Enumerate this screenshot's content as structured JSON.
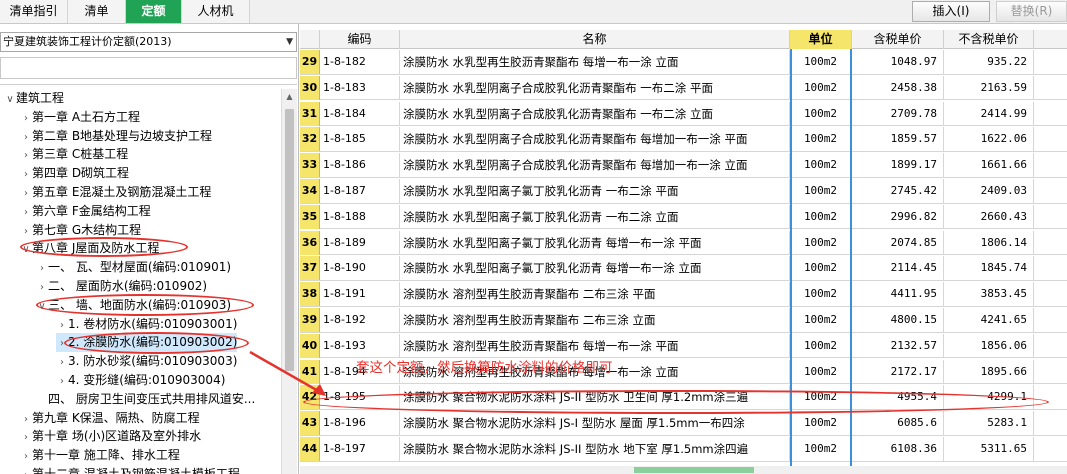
{
  "tabs": [
    {
      "label": "清单指引",
      "active": false
    },
    {
      "label": "清单",
      "active": false
    },
    {
      "label": "定额",
      "active": true
    },
    {
      "label": "人材机",
      "active": false
    }
  ],
  "toolbar": {
    "insert_label": "插入(I)",
    "replace_label": "替换(R)"
  },
  "library": {
    "selected": "宁夏建筑装饰工程计价定额(2013)"
  },
  "search": {
    "value": ""
  },
  "tree": [
    {
      "label": "建筑工程",
      "level": 0,
      "expanded": true
    },
    {
      "label": "第一章 A土石方工程",
      "level": 1
    },
    {
      "label": "第二章 B地基处理与边坡支护工程",
      "level": 1
    },
    {
      "label": "第三章 C桩基工程",
      "level": 1
    },
    {
      "label": "第四章 D砌筑工程",
      "level": 1
    },
    {
      "label": "第五章 E混凝土及钢筋混凝土工程",
      "level": 1
    },
    {
      "label": "第六章 F金属结构工程",
      "level": 1
    },
    {
      "label": "第七章 G木结构工程",
      "level": 1
    },
    {
      "label": "第八章 J屋面及防水工程",
      "level": 1,
      "expanded": true
    },
    {
      "label": "一、 瓦、型材屋面(编码:010901)",
      "level": 2
    },
    {
      "label": "二、 屋面防水(编码:010902)",
      "level": 2
    },
    {
      "label": "三、 墙、地面防水(编码:010903)",
      "level": 2,
      "expanded": true
    },
    {
      "label": "1. 卷材防水(编码:010903001)",
      "level": 3
    },
    {
      "label": "2. 涂膜防水(编码:010903002)",
      "level": 3,
      "selected": true
    },
    {
      "label": "3. 防水砂浆(编码:010903003)",
      "level": 3
    },
    {
      "label": "4. 变形缝(编码:010903004)",
      "level": 3
    },
    {
      "label": "四、 厨房卫生间变压式共用排风道安...",
      "level": 2,
      "noexp": true
    },
    {
      "label": "第九章 K保温、隔热、防腐工程",
      "level": 1
    },
    {
      "label": "第十章 场(小)区道路及室外排水",
      "level": 1
    },
    {
      "label": "第十一章 施工降、排水工程",
      "level": 1
    },
    {
      "label": "第十二章 混凝土及钢筋混凝土模板工程",
      "level": 1
    }
  ],
  "grid": {
    "headers": {
      "code": "编码",
      "name": "名称",
      "unit": "单位",
      "tax": "含税单价",
      "notax": "不含税单价"
    },
    "rows": [
      {
        "no": "29",
        "code": "1-8-182",
        "name": "涂膜防水 水乳型再生胶沥青聚酯布 每增一布一涂 立面",
        "unit": "100m2",
        "tax": "1048.97",
        "notax": "935.22"
      },
      {
        "no": "30",
        "code": "1-8-183",
        "name": "涂膜防水 水乳型阴离子合成胶乳化沥青聚酯布 一布二涂 平面",
        "unit": "100m2",
        "tax": "2458.38",
        "notax": "2163.59"
      },
      {
        "no": "31",
        "code": "1-8-184",
        "name": "涂膜防水 水乳型阴离子合成胶乳化沥青聚酯布 一布二涂 立面",
        "unit": "100m2",
        "tax": "2709.78",
        "notax": "2414.99"
      },
      {
        "no": "32",
        "code": "1-8-185",
        "name": "涂膜防水 水乳型阴离子合成胶乳化沥青聚酯布 每增加一布一涂 平面",
        "unit": "100m2",
        "tax": "1859.57",
        "notax": "1622.06"
      },
      {
        "no": "33",
        "code": "1-8-186",
        "name": "涂膜防水 水乳型阴离子合成胶乳化沥青聚酯布 每增加一布一涂 立面",
        "unit": "100m2",
        "tax": "1899.17",
        "notax": "1661.66"
      },
      {
        "no": "34",
        "code": "1-8-187",
        "name": "涂膜防水 水乳型阳离子氯丁胶乳化沥青 一布二涂 平面",
        "unit": "100m2",
        "tax": "2745.42",
        "notax": "2409.03"
      },
      {
        "no": "35",
        "code": "1-8-188",
        "name": "涂膜防水 水乳型阳离子氯丁胶乳化沥青 一布二涂 立面",
        "unit": "100m2",
        "tax": "2996.82",
        "notax": "2660.43"
      },
      {
        "no": "36",
        "code": "1-8-189",
        "name": "涂膜防水 水乳型阳离子氯丁胶乳化沥青 每增一布一涂 平面",
        "unit": "100m2",
        "tax": "2074.85",
        "notax": "1806.14"
      },
      {
        "no": "37",
        "code": "1-8-190",
        "name": "涂膜防水 水乳型阳离子氯丁胶乳化沥青 每增一布一涂 立面",
        "unit": "100m2",
        "tax": "2114.45",
        "notax": "1845.74"
      },
      {
        "no": "38",
        "code": "1-8-191",
        "name": "涂膜防水 溶剂型再生胶沥青聚酯布 二布三涂 平面",
        "unit": "100m2",
        "tax": "4411.95",
        "notax": "3853.45"
      },
      {
        "no": "39",
        "code": "1-8-192",
        "name": "涂膜防水 溶剂型再生胶沥青聚酯布 二布三涂 立面",
        "unit": "100m2",
        "tax": "4800.15",
        "notax": "4241.65"
      },
      {
        "no": "40",
        "code": "1-8-193",
        "name": "涂膜防水 溶剂型再生胶沥青聚酯布 每增一布一涂 平面",
        "unit": "100m2",
        "tax": "2132.57",
        "notax": "1856.06"
      },
      {
        "no": "41",
        "code": "1-8-194",
        "name": "涂膜防水 溶剂型再生胶沥青聚酯布 每增一布一涂 立面",
        "unit": "100m2",
        "tax": "2172.17",
        "notax": "1895.66"
      },
      {
        "no": "42",
        "code": "1-8-195",
        "name": "涂膜防水 聚合物水泥防水涂料 JS-II 型防水 卫生间 厚1.2mm涂三遍",
        "unit": "100m2",
        "tax": "4955.4",
        "notax": "4299.1"
      },
      {
        "no": "43",
        "code": "1-8-196",
        "name": "涂膜防水 聚合物水泥防水涂料 JS-I 型防水 屋面 厚1.5mm一布四涂",
        "unit": "100m2",
        "tax": "6085.6",
        "notax": "5283.1"
      },
      {
        "no": "44",
        "code": "1-8-197",
        "name": "涂膜防水 聚合物水泥防水涂料 JS-II 型防水 地下室 厚1.5mm涂四遍",
        "unit": "100m2",
        "tax": "6108.36",
        "notax": "5311.65"
      }
    ]
  },
  "annotation": {
    "text": "套这个定额，然后换算防水涂料的价格即可",
    "color": "#e5322d"
  },
  "colors": {
    "accent": "#21a355",
    "header_highlight": "#f5e56a",
    "unit_frame": "#3c8fd8",
    "annotation": "#e5322d"
  }
}
